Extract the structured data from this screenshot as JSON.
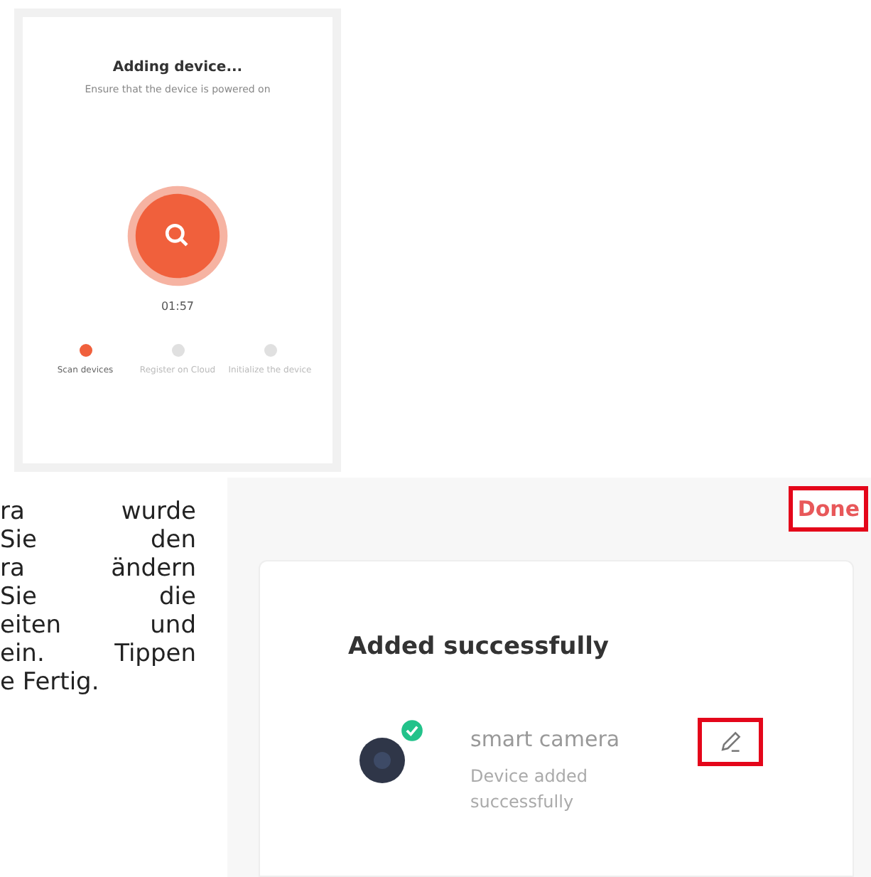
{
  "adding_screen": {
    "title": "Adding device...",
    "subtitle": "Ensure that the device is powered on",
    "timer": "01:57",
    "steps": [
      {
        "label": "Scan devices",
        "selected": true
      },
      {
        "label": "Register on Cloud",
        "selected": false
      },
      {
        "label": "Initialize the device",
        "selected": false
      }
    ]
  },
  "instruction_lines": [
    "ra wurde",
    "Sie den",
    "ra ändern",
    "Sie die",
    "eiten und",
    "ein. Tippen",
    "e Fertig."
  ],
  "result_screen": {
    "done_button": "Done",
    "title": "Added successfully",
    "device": {
      "name": "smart camera",
      "status": "Device added successfully",
      "checked": true
    }
  }
}
